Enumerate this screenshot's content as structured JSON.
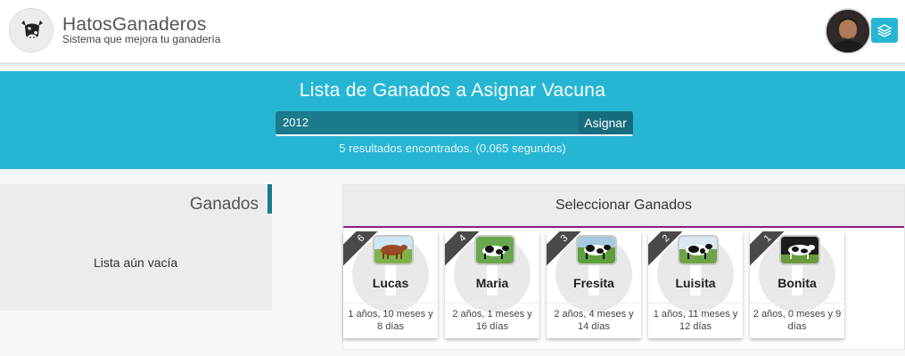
{
  "header": {
    "brand_title": "HatosGanaderos",
    "brand_subtitle": "Sistema que mejora tu ganadería"
  },
  "banner": {
    "title": "Lista de Ganados a Asignar Vacuna",
    "search_value": "2012",
    "assign_label": "Asignar",
    "results_text": "5 resultados encontrados. (0.065 segundos)"
  },
  "left_panel": {
    "title": "Ganados",
    "empty_text": "Lista aún vacía"
  },
  "right_panel": {
    "title": "Seleccionar Ganados"
  },
  "cattle": [
    {
      "number": "6",
      "name": "Lucas",
      "age": "1 años, 10 meses y 8 días",
      "photo": "brown-cow"
    },
    {
      "number": "4",
      "name": "Maria",
      "age": "2 años, 1 meses y 16 días",
      "photo": "holstein-cow"
    },
    {
      "number": "3",
      "name": "Fresita",
      "age": "2 años, 4 meses y 14 días",
      "photo": "holstein-cow"
    },
    {
      "number": "2",
      "name": "Luisita",
      "age": "1 años, 11 meses y 12 días",
      "photo": "holstein-cow"
    },
    {
      "number": "1",
      "name": "Bonita",
      "age": "2 años, 0 meses y 9 días",
      "photo": "holstein-cow"
    }
  ],
  "colors": {
    "accent": "#26b6d4",
    "dark_teal": "#1b7a8c",
    "purple_rule": "#8e1b7e",
    "ribbon": "#4a4a4a"
  },
  "icons": {
    "logo": "cow-head-icon",
    "layers": "layers-icon"
  }
}
